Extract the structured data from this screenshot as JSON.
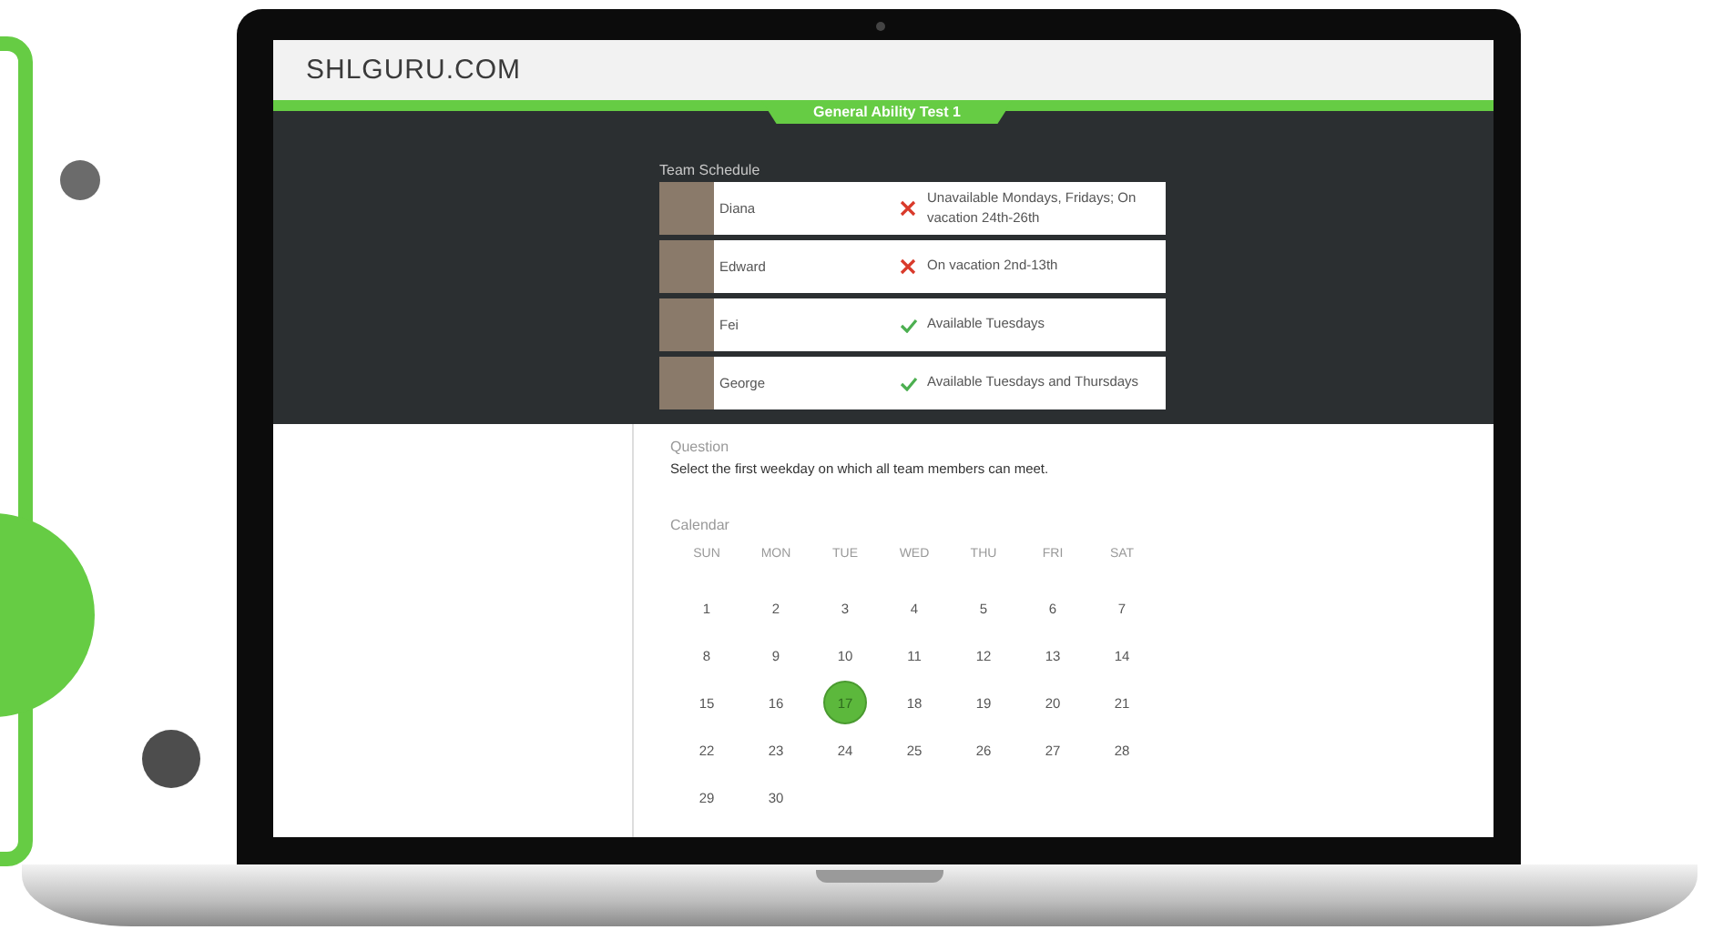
{
  "logo": "SHLGURU.COM",
  "test_tab": {
    "label": "General Ability Test 1"
  },
  "team_schedule": {
    "label": "Team Schedule",
    "members": [
      {
        "name": "Diana",
        "kind": "unavailable",
        "status": "Unavailable Mondays, Fridays; On vacation 24th-26th"
      },
      {
        "name": "Edward",
        "kind": "unavailable",
        "status": "On vacation 2nd-13th"
      },
      {
        "name": "Fei",
        "kind": "available",
        "status": "Available Tuesdays"
      },
      {
        "name": "George",
        "kind": "available",
        "status": "Available Tuesdays and Thursdays"
      }
    ]
  },
  "question": {
    "label": "Question",
    "text": "Select the first weekday on which all team members can meet."
  },
  "calendar": {
    "label": "Calendar",
    "weekdays": [
      "SUN",
      "MON",
      "TUE",
      "WED",
      "THU",
      "FRI",
      "SAT"
    ],
    "days": [
      {
        "label": "1",
        "selected": false
      },
      {
        "label": "2",
        "selected": false
      },
      {
        "label": "3",
        "selected": false
      },
      {
        "label": "4",
        "selected": false
      },
      {
        "label": "5",
        "selected": false
      },
      {
        "label": "6",
        "selected": false
      },
      {
        "label": "7",
        "selected": false
      },
      {
        "label": "8",
        "selected": false
      },
      {
        "label": "9",
        "selected": false
      },
      {
        "label": "10",
        "selected": false
      },
      {
        "label": "11",
        "selected": false
      },
      {
        "label": "12",
        "selected": false
      },
      {
        "label": "13",
        "selected": false
      },
      {
        "label": "14",
        "selected": false
      },
      {
        "label": "15",
        "selected": false
      },
      {
        "label": "16",
        "selected": false
      },
      {
        "label": "17",
        "selected": true
      },
      {
        "label": "18",
        "selected": false
      },
      {
        "label": "19",
        "selected": false
      },
      {
        "label": "20",
        "selected": false
      },
      {
        "label": "21",
        "selected": false
      },
      {
        "label": "22",
        "selected": false
      },
      {
        "label": "23",
        "selected": false
      },
      {
        "label": "24",
        "selected": false
      },
      {
        "label": "25",
        "selected": false
      },
      {
        "label": "26",
        "selected": false
      },
      {
        "label": "27",
        "selected": false
      },
      {
        "label": "28",
        "selected": false
      },
      {
        "label": "29",
        "selected": false
      },
      {
        "label": "30",
        "selected": false
      }
    ]
  }
}
